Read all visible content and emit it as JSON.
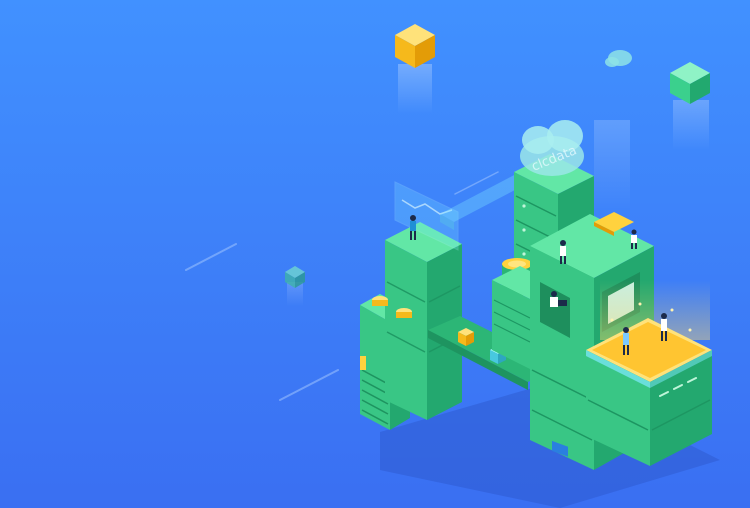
{
  "scene": {
    "cloud_label": "clcdata",
    "colors": {
      "bg_top": "#3f88ff",
      "bg_bottom": "#3a6ff2",
      "green_top": "#62e7a6",
      "green_left": "#39c685",
      "green_right": "#23a86f",
      "yellow": "#ffd23e",
      "cyan": "#7fe9ff"
    }
  }
}
